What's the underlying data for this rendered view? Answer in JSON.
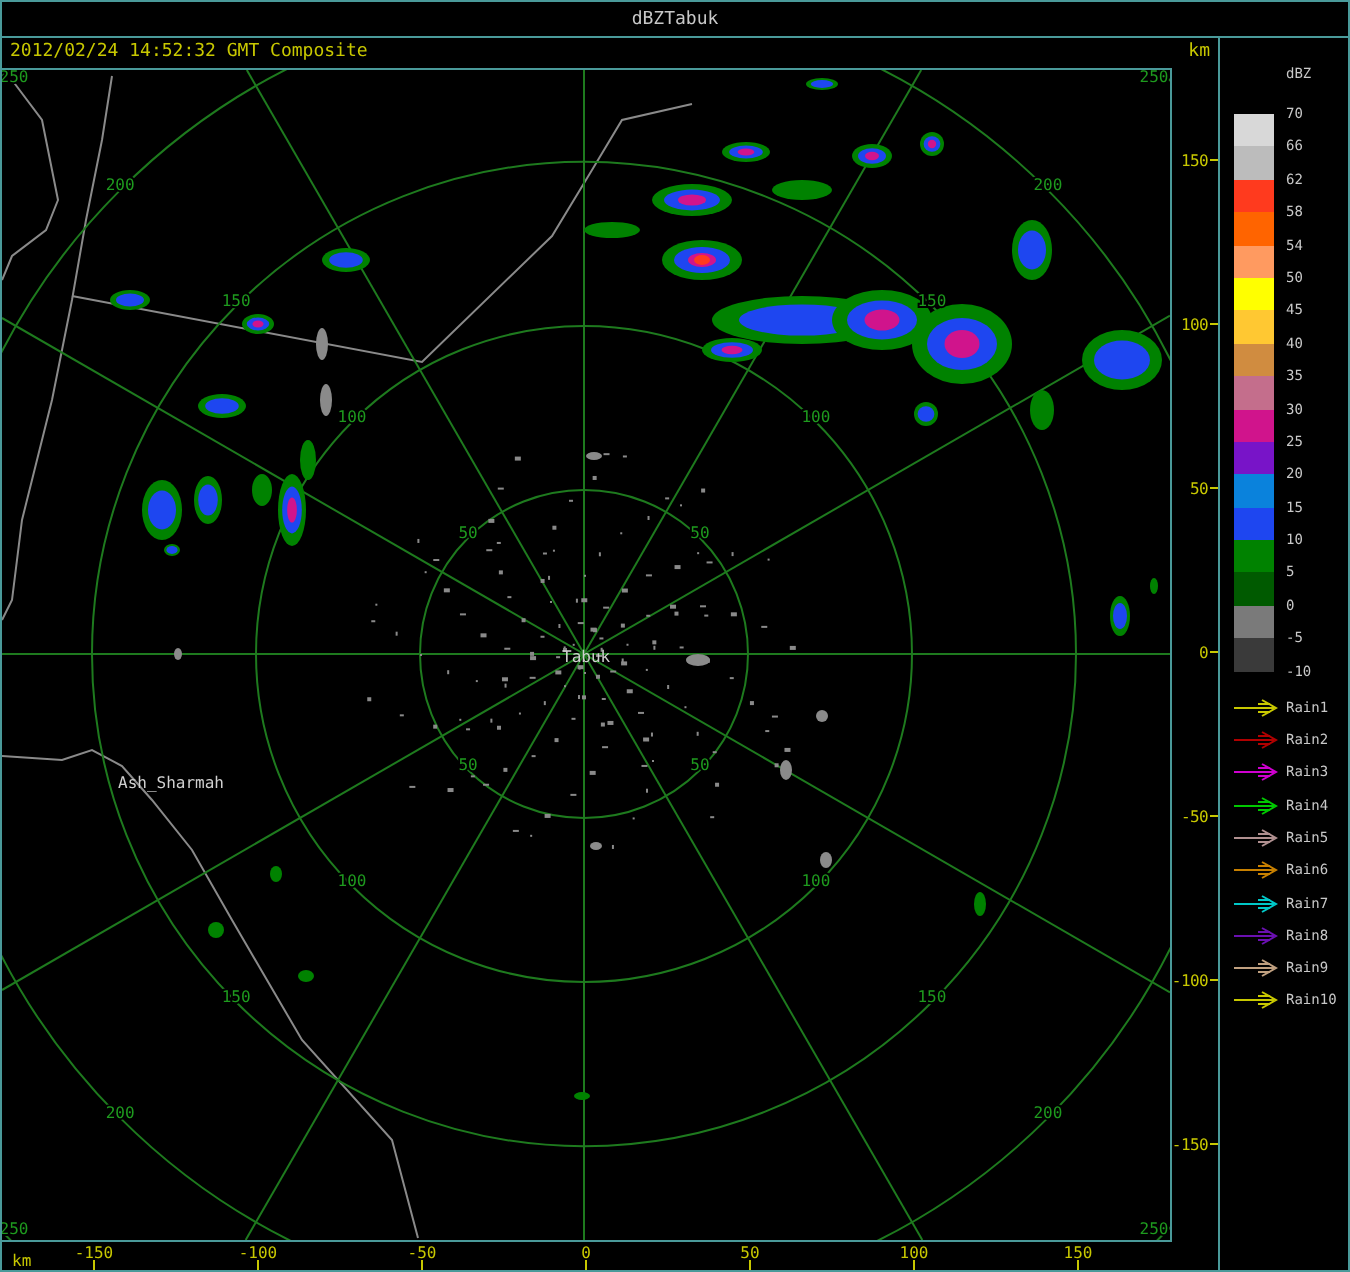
{
  "window": {
    "title": "dBZTabuk"
  },
  "plot": {
    "timestamp": "2012/02/24 14:52:32 GMT Composite",
    "unit_label": "km",
    "range_rings": [
      {
        "labels": [
          "50",
          "50",
          "50",
          "50"
        ]
      },
      {
        "labels": [
          "100",
          "100",
          "100",
          "100"
        ]
      },
      {
        "labels": [
          "150",
          "150",
          "150",
          "150"
        ]
      },
      {
        "labels": [
          "200",
          "200",
          "200",
          "200"
        ]
      },
      {
        "labels": [
          "250",
          "250",
          "250",
          "250"
        ]
      }
    ],
    "place_labels": [
      {
        "label": "Tabuk"
      },
      {
        "label": "Ash_Sharmah"
      }
    ],
    "y_axis": {
      "ticks": [
        "150",
        "100",
        "50",
        "0",
        "-50",
        "-100",
        "-150"
      ]
    },
    "x_axis": {
      "unit_label": "km",
      "ticks": [
        "-150",
        "-100",
        "-50",
        "0",
        "50",
        "100",
        "150"
      ]
    }
  },
  "legend": {
    "title": "dBZ",
    "scale": [
      {
        "label": "70",
        "color": "#d8d8d8"
      },
      {
        "label": "66",
        "color": "#bcbcbc"
      },
      {
        "label": "62",
        "color": "#ff3a1e"
      },
      {
        "label": "58",
        "color": "#ff6400"
      },
      {
        "label": "54",
        "color": "#ff9a60"
      },
      {
        "label": "50",
        "color": "#ffff00"
      },
      {
        "label": "45",
        "color": "#ffc832"
      },
      {
        "label": "40",
        "color": "#d08c40"
      },
      {
        "label": "35",
        "color": "#c46e8c"
      },
      {
        "label": "30",
        "color": "#d0148c"
      },
      {
        "label": "25",
        "color": "#7814c8"
      },
      {
        "label": "20",
        "color": "#0a82dc"
      },
      {
        "label": "15",
        "color": "#1e46f0"
      },
      {
        "label": "10",
        "color": "#008200"
      },
      {
        "label": "5",
        "color": "#005a00"
      },
      {
        "label": "0",
        "color": "#7a7a7a"
      },
      {
        "label": "-5",
        "color": "#3a3a3a"
      }
    ],
    "bottom_label": "-10",
    "tracks": [
      {
        "label": "Rain1",
        "color": "#c8c800"
      },
      {
        "label": "Rain2",
        "color": "#b00000"
      },
      {
        "label": "Rain3",
        "color": "#d000d0"
      },
      {
        "label": "Rain4",
        "color": "#00c800"
      },
      {
        "label": "Rain5",
        "color": "#b09090"
      },
      {
        "label": "Rain6",
        "color": "#c88000"
      },
      {
        "label": "Rain7",
        "color": "#00c8c8"
      },
      {
        "label": "Rain8",
        "color": "#6a10b0"
      },
      {
        "label": "Rain9",
        "color": "#c0a080"
      },
      {
        "label": "Rain10",
        "color": "#c8c800"
      }
    ]
  }
}
